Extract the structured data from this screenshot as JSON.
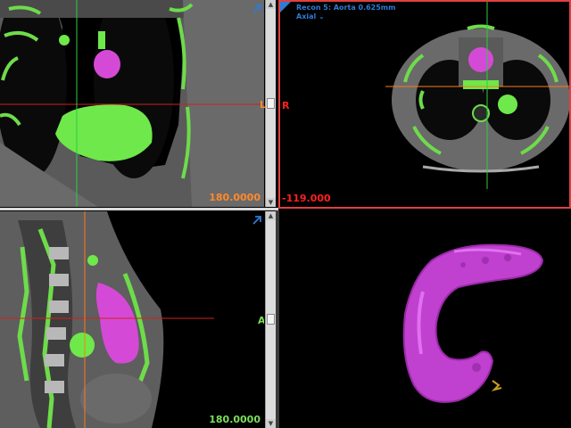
{
  "colors": {
    "accent_blue": "#2e7bd6",
    "orange": "#ff8a2a",
    "red": "#ff2020",
    "green": "#7ddf5a",
    "magenta": "#c040d0",
    "active_border": "#e04040",
    "crosshair_green": "#2ecc40",
    "crosshair_red": "#d02020",
    "crosshair_orange": "#ff7a1a"
  },
  "viewports": {
    "coronal": {
      "value": "180.0000"
    },
    "axial": {
      "title": "Recon 5: Aorta 0.625mm",
      "subtitle": "Axial",
      "value": "-119.000",
      "left_label": "L",
      "right_label": "R"
    },
    "sagittal": {
      "value": "180.0000",
      "side_label": "A"
    },
    "volume_3d": {}
  },
  "icons": {
    "maximize": "expand-arrow-icon",
    "chevron": "chevron-down-icon",
    "scroll_up": "arrow-up-icon",
    "scroll_down": "arrow-down-icon"
  }
}
